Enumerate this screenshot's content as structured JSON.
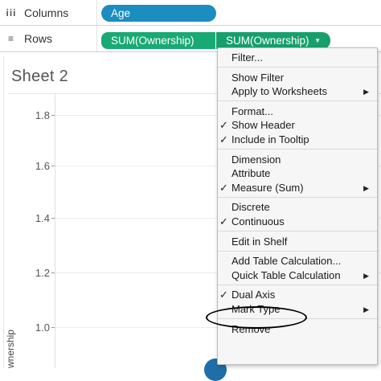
{
  "shelves": {
    "columns": {
      "icon": "iii",
      "label": "Columns",
      "pills": [
        "Age"
      ]
    },
    "rows": {
      "icon": "≡",
      "label": "Rows",
      "pills": [
        "SUM(Ownership)",
        "SUM(Ownership)"
      ]
    }
  },
  "sheet": {
    "title": "Sheet 2",
    "y_axis_label": "wnership",
    "y_ticks": [
      "1.8",
      "1.6",
      "1.4",
      "1.2",
      "1.0"
    ]
  },
  "context_menu": {
    "groups": [
      [
        {
          "label": "Filter...",
          "checked": false,
          "submenu": false
        }
      ],
      [
        {
          "label": "Show Filter",
          "checked": false,
          "submenu": false
        },
        {
          "label": "Apply to Worksheets",
          "checked": false,
          "submenu": true
        }
      ],
      [
        {
          "label": "Format...",
          "checked": false,
          "submenu": false
        },
        {
          "label": "Show Header",
          "checked": true,
          "submenu": false
        },
        {
          "label": "Include in Tooltip",
          "checked": true,
          "submenu": false
        }
      ],
      [
        {
          "label": "Dimension",
          "checked": false,
          "submenu": false
        },
        {
          "label": "Attribute",
          "checked": false,
          "submenu": false
        },
        {
          "label": "Measure (Sum)",
          "checked": true,
          "submenu": true
        }
      ],
      [
        {
          "label": "Discrete",
          "checked": false,
          "submenu": false
        },
        {
          "label": "Continuous",
          "checked": true,
          "submenu": false
        }
      ],
      [
        {
          "label": "Edit in Shelf",
          "checked": false,
          "submenu": false
        }
      ],
      [
        {
          "label": "Add Table Calculation...",
          "checked": false,
          "submenu": false
        },
        {
          "label": "Quick Table Calculation",
          "checked": false,
          "submenu": true
        }
      ],
      [
        {
          "label": "Dual Axis",
          "checked": true,
          "submenu": false
        },
        {
          "label": "Mark Type",
          "checked": false,
          "submenu": true
        }
      ],
      [
        {
          "label": "Remove",
          "checked": false,
          "submenu": false
        }
      ]
    ],
    "check_glyph": "✓",
    "submenu_glyph": "▶"
  },
  "colors": {
    "dimension_pill": "#1c8dbf",
    "measure_pill": "#18a974",
    "menu_bg": "#f6f6f6"
  }
}
